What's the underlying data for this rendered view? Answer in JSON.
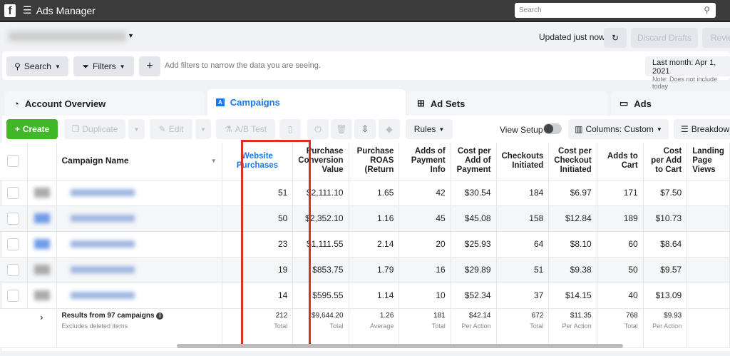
{
  "topbar": {
    "title": "Ads Manager",
    "search_placeholder": "Search"
  },
  "header": {
    "updated": "Updated just now",
    "discard": "Discard Drafts",
    "review": "Review"
  },
  "filterbar": {
    "search": "Search",
    "filters": "Filters",
    "hint": "Add filters to narrow the data you are seeing.",
    "date": "Last month: Apr 1, 2021",
    "date_note": "Note: Does not include today"
  },
  "tabs": [
    "Account Overview",
    "Campaigns",
    "Ad Sets",
    "Ads"
  ],
  "toolbar": {
    "create": "Create",
    "duplicate": "Duplicate",
    "edit": "Edit",
    "ab_test": "A/B Test",
    "rules": "Rules",
    "view_setup": "View Setup",
    "columns": "Columns: Custom",
    "breakdown": "Breakdown"
  },
  "table": {
    "headers": [
      "Campaign Name",
      "Website Purchases",
      "Purchase Conversion Value",
      "Purchase ROAS (Return",
      "Adds of Payment Info",
      "Cost per Add of Payment",
      "Checkouts Initiated",
      "Cost per Checkout Initiated",
      "Adds to Cart",
      "Cost per Add to Cart",
      "Landing Page Views"
    ],
    "rows": [
      [
        "51",
        "$2,111.10",
        "1.65",
        "42",
        "$30.54",
        "184",
        "$6.97",
        "171",
        "$7.50"
      ],
      [
        "50",
        "$2,352.10",
        "1.16",
        "45",
        "$45.08",
        "158",
        "$12.84",
        "189",
        "$10.73"
      ],
      [
        "23",
        "$1,111.55",
        "2.14",
        "20",
        "$25.93",
        "64",
        "$8.10",
        "60",
        "$8.64"
      ],
      [
        "19",
        "$853.75",
        "1.79",
        "16",
        "$29.89",
        "51",
        "$9.38",
        "50",
        "$9.57"
      ],
      [
        "14",
        "$595.55",
        "1.14",
        "10",
        "$52.34",
        "37",
        "$14.15",
        "40",
        "$13.09"
      ]
    ],
    "totals": {
      "label": "Results from 97 campaigns",
      "sub": "Excludes deleted items",
      "values": [
        "212",
        "$9,644.20",
        "1.26",
        "181",
        "$42.14",
        "672",
        "$11.35",
        "768",
        "$9.93"
      ],
      "kinds": [
        "Total",
        "Total",
        "Average",
        "Total",
        "Per Action",
        "Total",
        "Per Action",
        "Total",
        "Per Action"
      ]
    }
  },
  "colors": {
    "highlight": "#d93025",
    "accent": "#1877f2",
    "create": "#42b72a"
  }
}
